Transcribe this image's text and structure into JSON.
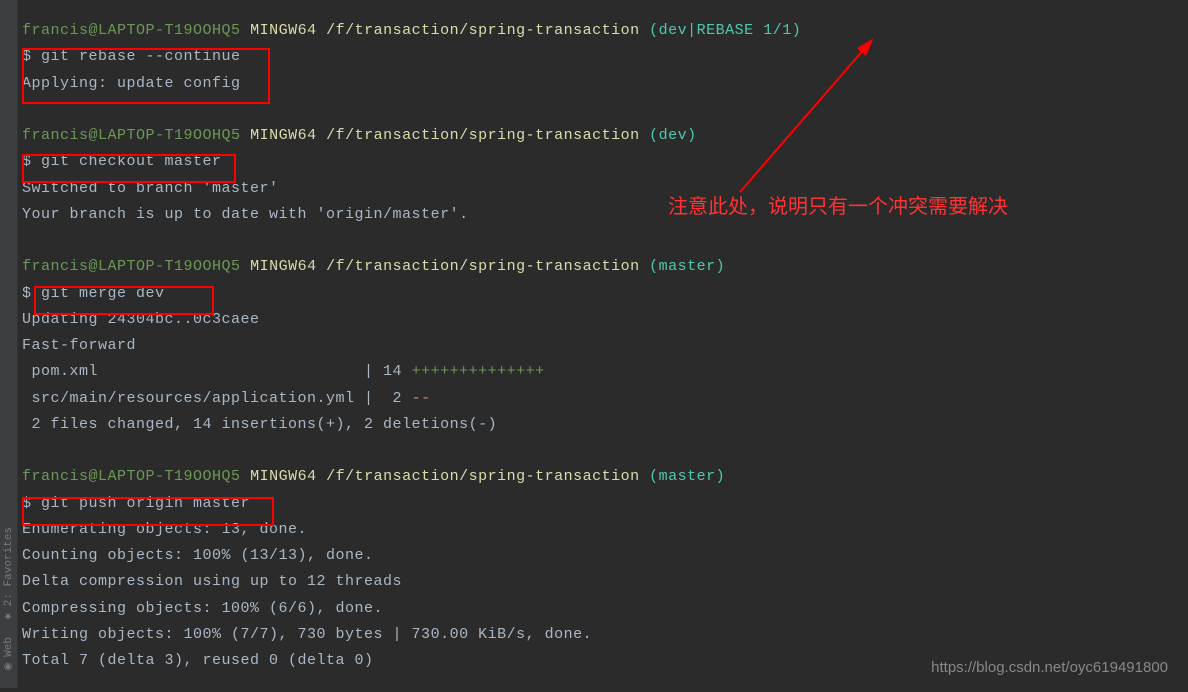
{
  "sidebar": {
    "favorites": "2: Favorites",
    "web": "Web"
  },
  "prompts": [
    {
      "user": "francis@LAPTOP-T19OOHQ5",
      "env": "MINGW64",
      "path": "/f/transaction/spring-transaction",
      "branch": "(dev|REBASE 1/1)"
    },
    {
      "user": "francis@LAPTOP-T19OOHQ5",
      "env": "MINGW64",
      "path": "/f/transaction/spring-transaction",
      "branch": "(dev)"
    },
    {
      "user": "francis@LAPTOP-T19OOHQ5",
      "env": "MINGW64",
      "path": "/f/transaction/spring-transaction",
      "branch": "(master)"
    },
    {
      "user": "francis@LAPTOP-T19OOHQ5",
      "env": "MINGW64",
      "path": "/f/transaction/spring-transaction",
      "branch": "(master)"
    }
  ],
  "commands": {
    "rebase": "$ git rebase --continue",
    "checkout": "$ git checkout master",
    "merge": "$ git merge dev",
    "push": "$ git push origin master"
  },
  "output": {
    "applying": "Applying: update config",
    "switched": "Switched to branch 'master'",
    "uptodate": "Your branch is up to date with 'origin/master'.",
    "updating": "Updating 24304bc..0c3caee",
    "fastforward": "Fast-forward",
    "pom": " pom.xml                            | 14 ",
    "pom_plus": "++++++++++++++",
    "appyml": " src/main/resources/application.yml |  2 ",
    "appyml_minus": "--",
    "changed": " 2 files changed, 14 insertions(+), 2 deletions(-)",
    "enum": "Enumerating objects: 13, done.",
    "counting": "Counting objects: 100% (13/13), done.",
    "delta": "Delta compression using up to 12 threads",
    "compress": "Compressing objects: 100% (6/6), done.",
    "writing": "Writing objects: 100% (7/7), 730 bytes | 730.00 KiB/s, done.",
    "total": "Total 7 (delta 3), reused 0 (delta 0)"
  },
  "annotation": "注意此处，说明只有一个冲突需要解决",
  "watermark": "https://blog.csdn.net/oyc619491800"
}
